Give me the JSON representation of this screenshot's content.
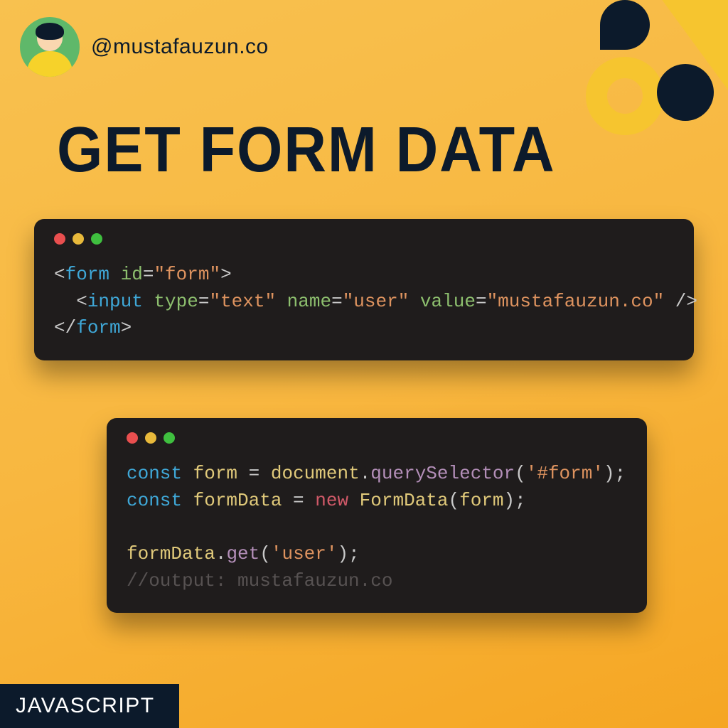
{
  "handle": "@mustafauzun.co",
  "title": "GET FORM DATA",
  "badge": "JAVASCRIPT",
  "colors": {
    "bg_start": "#f8c14f",
    "bg_end": "#f5a623",
    "dark": "#0c1a2b",
    "accent": "#f6c52f"
  },
  "window1": {
    "tokens": [
      {
        "t": "<",
        "c": "c-plain"
      },
      {
        "t": "form",
        "c": "c-blue"
      },
      {
        "t": " id",
        "c": "c-green"
      },
      {
        "t": "=",
        "c": "c-plain"
      },
      {
        "t": "\"form\"",
        "c": "c-orange"
      },
      {
        "t": ">",
        "c": "c-plain"
      },
      {
        "t": "\n",
        "c": ""
      },
      {
        "t": "  <",
        "c": "c-plain"
      },
      {
        "t": "input",
        "c": "c-blue"
      },
      {
        "t": " type",
        "c": "c-green"
      },
      {
        "t": "=",
        "c": "c-plain"
      },
      {
        "t": "\"text\"",
        "c": "c-orange"
      },
      {
        "t": " name",
        "c": "c-green"
      },
      {
        "t": "=",
        "c": "c-plain"
      },
      {
        "t": "\"user\"",
        "c": "c-orange"
      },
      {
        "t": " value",
        "c": "c-green"
      },
      {
        "t": "=",
        "c": "c-plain"
      },
      {
        "t": "\"mustafauzun.co\"",
        "c": "c-orange"
      },
      {
        "t": " />",
        "c": "c-plain"
      },
      {
        "t": "\n",
        "c": ""
      },
      {
        "t": "</",
        "c": "c-plain"
      },
      {
        "t": "form",
        "c": "c-blue"
      },
      {
        "t": ">",
        "c": "c-plain"
      }
    ]
  },
  "window2": {
    "tokens": [
      {
        "t": "const",
        "c": "c-blue"
      },
      {
        "t": " form ",
        "c": "c-yellow"
      },
      {
        "t": "= ",
        "c": "c-plain"
      },
      {
        "t": "document",
        "c": "c-yellow"
      },
      {
        "t": ".",
        "c": "c-plain"
      },
      {
        "t": "querySelector",
        "c": "c-mauve"
      },
      {
        "t": "(",
        "c": "c-plain"
      },
      {
        "t": "'#form'",
        "c": "c-orange"
      },
      {
        "t": ");",
        "c": "c-plain"
      },
      {
        "t": "\n",
        "c": ""
      },
      {
        "t": "const",
        "c": "c-blue"
      },
      {
        "t": " formData ",
        "c": "c-yellow"
      },
      {
        "t": "= ",
        "c": "c-plain"
      },
      {
        "t": "new",
        "c": "c-red"
      },
      {
        "t": " FormData",
        "c": "c-yellow"
      },
      {
        "t": "(",
        "c": "c-plain"
      },
      {
        "t": "form",
        "c": "c-yellow"
      },
      {
        "t": ");",
        "c": "c-plain"
      },
      {
        "t": "\n\n",
        "c": ""
      },
      {
        "t": "formData",
        "c": "c-yellow"
      },
      {
        "t": ".",
        "c": "c-plain"
      },
      {
        "t": "get",
        "c": "c-mauve"
      },
      {
        "t": "(",
        "c": "c-plain"
      },
      {
        "t": "'user'",
        "c": "c-orange"
      },
      {
        "t": ");",
        "c": "c-plain"
      },
      {
        "t": "\n",
        "c": ""
      },
      {
        "t": "//output: mustafauzun.co",
        "c": "c-dim"
      }
    ]
  }
}
